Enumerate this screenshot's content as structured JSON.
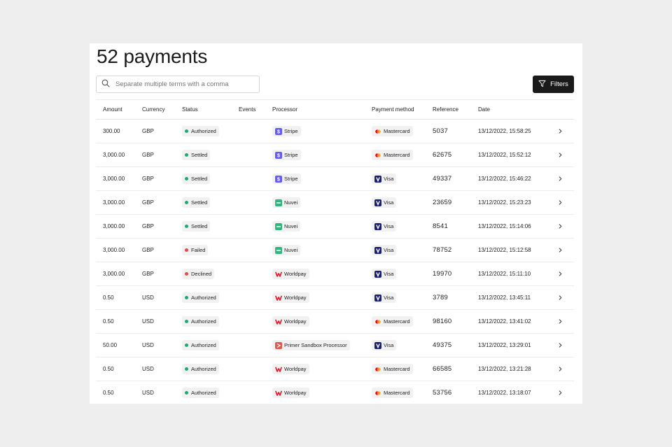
{
  "page": {
    "title": "52 payments"
  },
  "search": {
    "placeholder": "Separate multiple terms with a comma",
    "icon": "search-icon"
  },
  "filters": {
    "label": "Filters",
    "icon": "filter-icon"
  },
  "table": {
    "headers": {
      "amount": "Amount",
      "currency": "Currency",
      "status": "Status",
      "events": "Events",
      "processor": "Processor",
      "method": "Payment method",
      "reference": "Reference",
      "date": "Date"
    },
    "rows": [
      {
        "amount": "300.00",
        "currency": "GBP",
        "status": "Authorized",
        "status_color": "#1fa971",
        "processor": "Stripe",
        "processor_logo": "stripe",
        "method": "Mastercard",
        "method_logo": "mastercard",
        "reference": "5037",
        "date": "13/12/2022, 15:58:25"
      },
      {
        "amount": "3,000.00",
        "currency": "GBP",
        "status": "Settled",
        "status_color": "#1fa971",
        "processor": "Stripe",
        "processor_logo": "stripe",
        "method": "Mastercard",
        "method_logo": "mastercard",
        "reference": "62675",
        "date": "13/12/2022, 15:52:12"
      },
      {
        "amount": "3,000.00",
        "currency": "GBP",
        "status": "Settled",
        "status_color": "#1fa971",
        "processor": "Stripe",
        "processor_logo": "stripe",
        "method": "Visa",
        "method_logo": "visa",
        "reference": "49337",
        "date": "13/12/2022, 15:46:22"
      },
      {
        "amount": "3,000.00",
        "currency": "GBP",
        "status": "Settled",
        "status_color": "#1fa971",
        "processor": "Nuvei",
        "processor_logo": "nuvei",
        "method": "Visa",
        "method_logo": "visa",
        "reference": "23659",
        "date": "13/12/2022, 15:23:23"
      },
      {
        "amount": "3,000.00",
        "currency": "GBP",
        "status": "Settled",
        "status_color": "#1fa971",
        "processor": "Nuvei",
        "processor_logo": "nuvei",
        "method": "Visa",
        "method_logo": "visa",
        "reference": "8541",
        "date": "13/12/2022, 15:14:06"
      },
      {
        "amount": "3,000.00",
        "currency": "GBP",
        "status": "Failed",
        "status_color": "#e5484d",
        "processor": "Nuvei",
        "processor_logo": "nuvei",
        "method": "Visa",
        "method_logo": "visa",
        "reference": "78752",
        "date": "13/12/2022, 15:12:58"
      },
      {
        "amount": "3,000.00",
        "currency": "GBP",
        "status": "Declined",
        "status_color": "#e5484d",
        "processor": "Worldpay",
        "processor_logo": "worldpay",
        "method": "Visa",
        "method_logo": "visa",
        "reference": "19970",
        "date": "13/12/2022, 15:11:10"
      },
      {
        "amount": "0.50",
        "currency": "USD",
        "status": "Authorized",
        "status_color": "#1fa971",
        "processor": "Worldpay",
        "processor_logo": "worldpay",
        "method": "Visa",
        "method_logo": "visa",
        "reference": "3789",
        "date": "13/12/2022, 13:45:11"
      },
      {
        "amount": "0.50",
        "currency": "USD",
        "status": "Authorized",
        "status_color": "#1fa971",
        "processor": "Worldpay",
        "processor_logo": "worldpay",
        "method": "Mastercard",
        "method_logo": "mastercard",
        "reference": "98160",
        "date": "13/12/2022, 13:41:02"
      },
      {
        "amount": "50.00",
        "currency": "USD",
        "status": "Authorized",
        "status_color": "#1fa971",
        "processor": "Primer Sandbox Processor",
        "processor_logo": "primer",
        "method": "Visa",
        "method_logo": "visa",
        "reference": "49375",
        "date": "13/12/2022, 13:29:01"
      },
      {
        "amount": "0.50",
        "currency": "USD",
        "status": "Authorized",
        "status_color": "#1fa971",
        "processor": "Worldpay",
        "processor_logo": "worldpay",
        "method": "Mastercard",
        "method_logo": "mastercard",
        "reference": "66585",
        "date": "13/12/2022, 13:21:28"
      },
      {
        "amount": "0.50",
        "currency": "USD",
        "status": "Authorized",
        "status_color": "#1fa971",
        "processor": "Worldpay",
        "processor_logo": "worldpay",
        "method": "Mastercard",
        "method_logo": "mastercard",
        "reference": "53756",
        "date": "13/12/2022, 13:18:07"
      }
    ]
  },
  "colors": {
    "success": "#1fa971",
    "error": "#e5484d",
    "button_bg": "#1a1a1a",
    "stripe": "#635bff",
    "nuvei": "#2fb57e",
    "worldpay": "#e4192b",
    "visa": "#1a1f71",
    "primer": "#e4574a"
  }
}
